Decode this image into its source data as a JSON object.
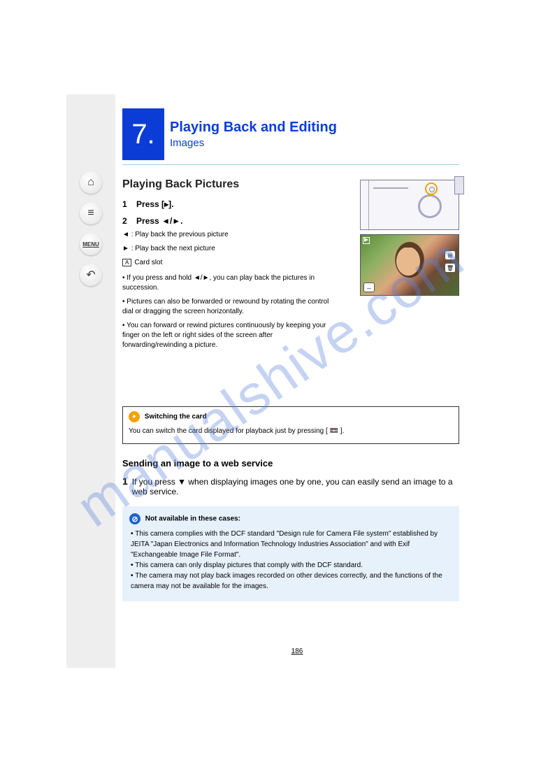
{
  "sidebar": {
    "home": "⌂",
    "list": "≡",
    "menu": "MENU",
    "back": "↶"
  },
  "header": {
    "chapter_top": "7.",
    "chapter_title_line1": "Playing Back and Editing",
    "chapter_title_line2": "Images"
  },
  "section": {
    "title": "Playing Back Pictures",
    "step1_label": "1",
    "step1_text": "Press [",
    "step1_icon": "▸",
    "step1_text2": "].",
    "step2_label": "2",
    "step2_text_a": "Press ",
    "step2_arrows": "◄/►",
    "step2_text_b": ".",
    "step2_note1_a": "◄",
    "step2_note1_b": ": Play back the previous picture",
    "step2_note2_a": "►",
    "step2_note2_b": ": Play back the next picture",
    "label_a": "A",
    "label_a_desc": "Card slot",
    "long_note": "If you press and hold ◄/►, you can play back the pictures in succession.",
    "rotary_note": "Pictures can also be forwarded or rewound by rotating the control dial or dragging the screen horizontally.",
    "keep_finger_note": "You can forward or rewind pictures continuously by keeping your finger on the left or right sides of the screen after forwarding/rewinding a picture.",
    "tip": {
      "title": "Switching the card ",
      "body": "You can switch the card displayed for playback just by pressing [ 📼 ]."
    },
    "send_title": "Sending an image to a web service",
    "send_step_n": "1",
    "send_step": "If you press ▼ when displaying images one by one, you can easily send an image to a web service."
  },
  "na": {
    "heading": "Not available in these cases:",
    "items": [
      "This camera complies with the DCF standard \"Design rule for Camera File system\" established by JEITA \"Japan Electronics and Information Technology Industries Association\" and with Exif \"Exchangeable Image File Format\".",
      "This camera can only display pictures that comply with the DCF standard.",
      "The camera may not play back images recorded on other devices correctly, and the functions of the camera may not be available for the images."
    ]
  },
  "page_number": "186"
}
